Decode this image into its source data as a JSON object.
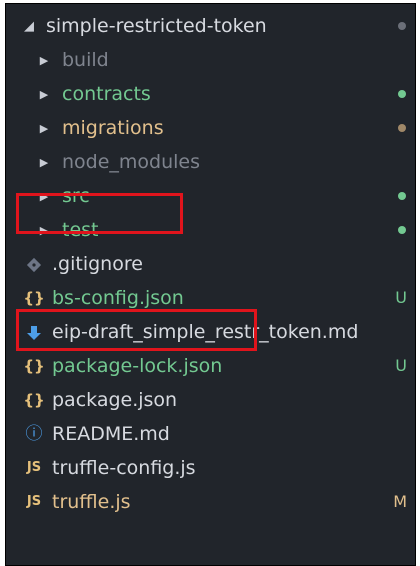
{
  "colors": {
    "background": "#21252b",
    "text_default": "#d7dae0",
    "text_ignored": "#7f848e",
    "text_modified": "#6ec26e",
    "text_untracked": "#73c991",
    "dot_green": "#73c991",
    "dot_tan": "#a08868",
    "json_icon": "#e5c07b",
    "js_icon": "#e5c07b",
    "md_arrow_icon": "#4d9ee8",
    "info_icon": "#4d9ee8",
    "status_letter": "#d19a66",
    "highlight": "#e0141c"
  },
  "explorer": {
    "root": {
      "label": "simple-restricted-token",
      "arrow": "◢"
    },
    "folders": [
      {
        "label": "build",
        "arrow": "▶"
      },
      {
        "label": "contracts",
        "arrow": "▶"
      },
      {
        "label": "migrations",
        "arrow": "▶"
      },
      {
        "label": "node_modules",
        "arrow": "▶"
      },
      {
        "label": "src",
        "arrow": "▶"
      },
      {
        "label": "test",
        "arrow": "▶"
      }
    ],
    "files": [
      {
        "label": ".gitignore",
        "icon": "git-diamond-icon"
      },
      {
        "label": "bs-config.json",
        "icon": "json-braces-icon",
        "icon_text": "{}",
        "status": "U"
      },
      {
        "label": "eip-draft_simple_restr_token.md",
        "icon": "markdown-arrow-icon"
      },
      {
        "label": "package-lock.json",
        "icon": "json-braces-icon",
        "icon_text": "{}",
        "status": "U"
      },
      {
        "label": "package.json",
        "icon": "json-braces-icon",
        "icon_text": "{}"
      },
      {
        "label": "README.md",
        "icon": "info-icon",
        "icon_text": "ⓘ"
      },
      {
        "label": "truffle-config.js",
        "icon": "js-icon",
        "icon_text": "JS"
      },
      {
        "label": "truffle.js",
        "icon": "js-icon",
        "icon_text": "JS",
        "status": "M"
      }
    ]
  }
}
